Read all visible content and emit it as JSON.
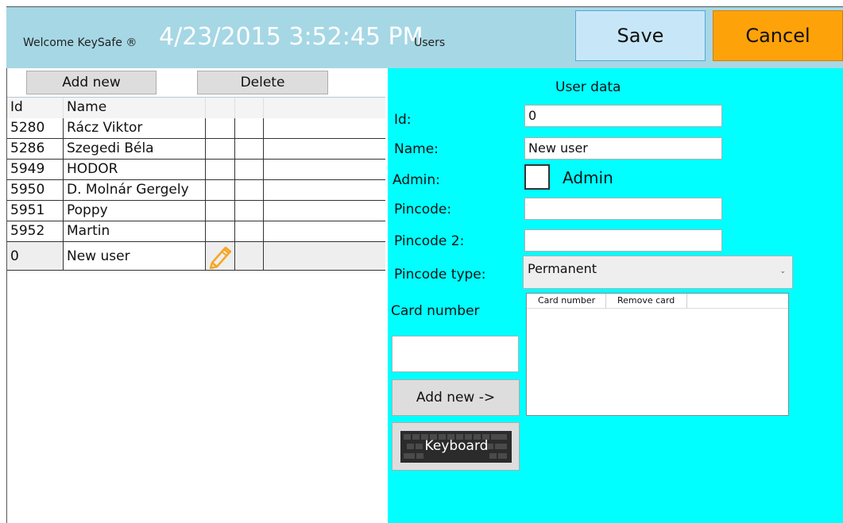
{
  "header": {
    "welcome": "Welcome KeySafe ®",
    "datetime": "4/23/2015 3:52:45 PM",
    "page": "Users",
    "save_label": "Save",
    "cancel_label": "Cancel"
  },
  "left": {
    "add_new_label": "Add new",
    "delete_label": "Delete",
    "grid": {
      "columns": [
        "Id",
        "Name",
        "",
        "",
        ""
      ],
      "rows": [
        {
          "id": "5280",
          "name": "Rácz Viktor"
        },
        {
          "id": "5286",
          "name": "Szegedi Béla"
        },
        {
          "id": "5949",
          "name": "HODOR"
        },
        {
          "id": "5950",
          "name": "D. Molnár Gergely"
        },
        {
          "id": "5951",
          "name": "Poppy"
        },
        {
          "id": "5952",
          "name": "Martin"
        },
        {
          "id": "0",
          "name": "New user"
        }
      ],
      "selected_index": 6,
      "edit_icon": "pencil-icon"
    }
  },
  "user_data": {
    "title": "User data",
    "id_label": "Id:",
    "id_value": "0",
    "name_label": "Name:",
    "name_value": "New user",
    "admin_label": "Admin:",
    "admin_checkbox_label": "Admin",
    "admin_checked": false,
    "pincode_label": "Pincode:",
    "pincode_value": "",
    "pincode2_label": "Pincode 2:",
    "pincode2_value": "",
    "pincode_type_label": "Pincode type:",
    "pincode_type_value": "Permanent",
    "card_number_label": "Card number",
    "card_number_value": "",
    "add_new_label": "Add new ->",
    "keyboard_label": "Keyboard",
    "card_grid_columns": [
      "Card number",
      "Remove card"
    ]
  },
  "colors": {
    "header_bg": "#a6d7e5",
    "save_bg": "#c7e7f8",
    "cancel_bg": "#fea20a",
    "panel_bg": "#00ffff",
    "pencil": "#f5a623"
  }
}
